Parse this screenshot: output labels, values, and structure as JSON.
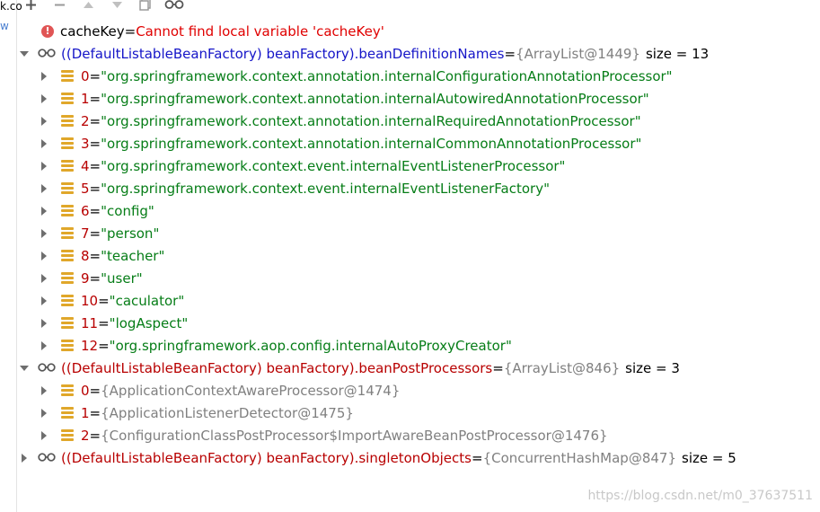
{
  "toolbar": {
    "buttons": [
      {
        "name": "add-icon",
        "glyph": "+"
      },
      {
        "name": "remove-icon",
        "glyph": "−"
      },
      {
        "name": "up-icon",
        "glyph": "▲"
      },
      {
        "name": "down-icon",
        "glyph": "▼"
      },
      {
        "name": "copy-icon",
        "glyph": "▣"
      },
      {
        "name": "glasses-icon",
        "glyph": "oo"
      }
    ]
  },
  "gutter": {
    "line1": "k.co",
    "line2": "w"
  },
  "error_row": {
    "name": "cacheKey",
    "eq": " = ",
    "message": "Cannot find local variable 'cacheKey'"
  },
  "bean_definition_names": {
    "name": "((DefaultListableBeanFactory) beanFactory).beanDefinitionNames",
    "eq": " = ",
    "ref": "{ArrayList@1449}",
    "size": "size = 13",
    "items": [
      {
        "index": "0",
        "value": "\"org.springframework.context.annotation.internalConfigurationAnnotationProcessor\""
      },
      {
        "index": "1",
        "value": "\"org.springframework.context.annotation.internalAutowiredAnnotationProcessor\""
      },
      {
        "index": "2",
        "value": "\"org.springframework.context.annotation.internalRequiredAnnotationProcessor\""
      },
      {
        "index": "3",
        "value": "\"org.springframework.context.annotation.internalCommonAnnotationProcessor\""
      },
      {
        "index": "4",
        "value": "\"org.springframework.context.event.internalEventListenerProcessor\""
      },
      {
        "index": "5",
        "value": "\"org.springframework.context.event.internalEventListenerFactory\""
      },
      {
        "index": "6",
        "value": "\"config\""
      },
      {
        "index": "7",
        "value": "\"person\""
      },
      {
        "index": "8",
        "value": "\"teacher\""
      },
      {
        "index": "9",
        "value": "\"user\""
      },
      {
        "index": "10",
        "value": "\"caculator\""
      },
      {
        "index": "11",
        "value": "\"logAspect\""
      },
      {
        "index": "12",
        "value": "\"org.springframework.aop.config.internalAutoProxyCreator\""
      }
    ]
  },
  "bean_post_processors": {
    "name": "((DefaultListableBeanFactory) beanFactory).beanPostProcessors",
    "eq": " = ",
    "ref": "{ArrayList@846}",
    "size": "size = 3",
    "items": [
      {
        "index": "0",
        "value": "{ApplicationContextAwareProcessor@1474}"
      },
      {
        "index": "1",
        "value": "{ApplicationListenerDetector@1475}"
      },
      {
        "index": "2",
        "value": "{ConfigurationClassPostProcessor$ImportAwareBeanPostProcessor@1476}"
      }
    ]
  },
  "singleton_objects": {
    "name": "((DefaultListableBeanFactory) beanFactory).singletonObjects",
    "eq": " = ",
    "ref": "{ConcurrentHashMap@847}",
    "size": "size = 5"
  },
  "watermark": "https://blog.csdn.net/m0_37637511",
  "colors": {
    "string_value": "#067d17",
    "error_text": "#e00000",
    "reference": "#808080",
    "expression_blue": "#1515c8",
    "field_red": "#b80000",
    "list_icon": "#e0a72a"
  }
}
